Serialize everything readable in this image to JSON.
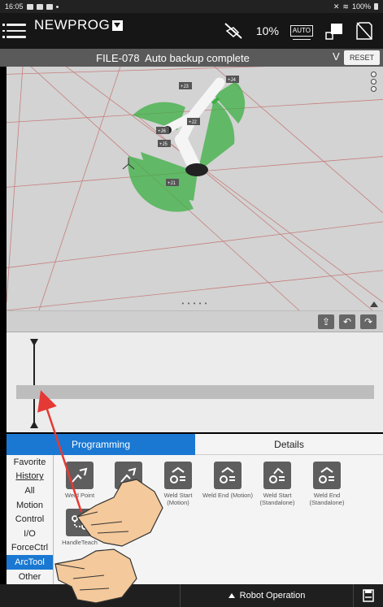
{
  "status_bar": {
    "time": "16:05",
    "battery": "100%"
  },
  "header": {
    "program_name": "NEWPROG",
    "speed": "10%",
    "mode_icon_text": "AUTO"
  },
  "banner": {
    "file": "FILE-078",
    "message": "Auto backup complete",
    "expand": "V",
    "reset_label": "RESET"
  },
  "view3d": {
    "joint_labels": [
      "+J1",
      "+J2",
      "+J3",
      "+J4",
      "+J5",
      "+J6"
    ],
    "handle": "• • • • •"
  },
  "tabs": {
    "programming": "Programming",
    "details": "Details"
  },
  "categories": [
    "Favorite",
    "History",
    "All",
    "Motion",
    "Control",
    "I/O",
    "ForceCtrl",
    "ArcTool",
    "Other"
  ],
  "instructions": [
    {
      "label": "Weld Point",
      "icon": "weld-point-icon"
    },
    {
      "label": "Weld",
      "icon": "weld-icon"
    },
    {
      "label": "Weld Start (Motion)",
      "icon": "weld-start-motion-icon"
    },
    {
      "label": "Weld End (Motion)",
      "icon": "weld-end-motion-icon"
    },
    {
      "label": "Weld Start (Standalone)",
      "icon": "weld-start-standalone-icon"
    },
    {
      "label": "Weld End (Standalone)",
      "icon": "weld-end-standalone-icon"
    },
    {
      "label": "HandleTeach",
      "icon": "handle-teach-icon"
    }
  ],
  "bottom_bar": {
    "left_label": "Play",
    "robot_operation": "Robot Operation"
  },
  "colors": {
    "accent": "#1a78d2",
    "robot_green": "#3cb043",
    "arrow_red": "#e53935"
  }
}
